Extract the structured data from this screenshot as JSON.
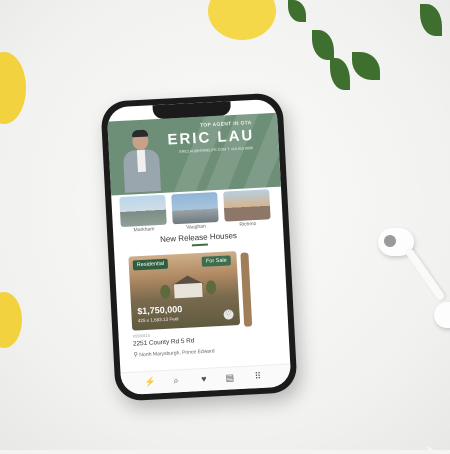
{
  "banner": {
    "top_agent": "TOP AGENT IN GTA",
    "name": "ERIC LAU",
    "contact": "ERICLAU@HOMELIFE.COM T: 416 816 8888"
  },
  "cities": [
    {
      "label": "Markham"
    },
    {
      "label": "Vaughan"
    },
    {
      "label": "Richmo"
    }
  ],
  "section": {
    "title": "New Release Houses"
  },
  "listing": {
    "type_badge": "Residential",
    "status_badge": "For Sale",
    "price": "$1,750,000",
    "size": "425 x 1,683.13 Feet",
    "mls": "X5580515",
    "address": "2251 County Rd 5 Rd",
    "location": "North Marysburgh, Prince Edward"
  },
  "tabbar": {
    "home_icon": "lightning-icon",
    "search_icon": "search-icon",
    "favorites_icon": "heart-icon",
    "map_icon": "map-icon",
    "menu_icon": "grid-icon"
  },
  "colors": {
    "accent": "#3c6e4e",
    "banner": "#6d8f78"
  }
}
